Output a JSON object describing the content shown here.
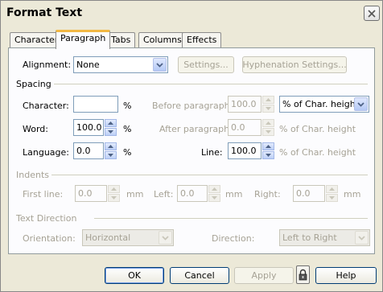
{
  "window": {
    "title": "Format Text"
  },
  "tabs": [
    {
      "label": "Character"
    },
    {
      "label": "Paragraph"
    },
    {
      "label": "Tabs"
    },
    {
      "label": "Columns"
    },
    {
      "label": "Effects"
    }
  ],
  "alignment": {
    "label": "Alignment:",
    "value": "None",
    "settings_label": "Settings...",
    "hyphenation_label": "Hyphenation Settings..."
  },
  "spacing": {
    "group_label": "Spacing",
    "character": {
      "label": "Character:",
      "value": "",
      "unit": "%"
    },
    "word": {
      "label": "Word:",
      "value": "100.0",
      "unit": "%"
    },
    "language": {
      "label": "Language:",
      "value": "0.0",
      "unit": "%"
    },
    "before_paragraph": {
      "label": "Before paragraph:",
      "value": "100.0",
      "unit_select": "% of Char. height"
    },
    "after_paragraph": {
      "label": "After paragraph:",
      "value": "0.0",
      "unit": "% of Char. height"
    },
    "line": {
      "label": "Line:",
      "value": "100.0",
      "unit": "% of Char. height"
    }
  },
  "indents": {
    "group_label": "Indents",
    "first_line": {
      "label": "First line:",
      "value": "0.0",
      "unit": "mm"
    },
    "left": {
      "label": "Left:",
      "value": "0.0",
      "unit": "mm"
    },
    "right": {
      "label": "Right:",
      "value": "0.0",
      "unit": "mm"
    }
  },
  "text_direction": {
    "group_label": "Text Direction",
    "orientation": {
      "label": "Orientation:",
      "value": "Horizontal"
    },
    "direction": {
      "label": "Direction:",
      "value": "Left to Right"
    }
  },
  "buttons": {
    "ok": "OK",
    "cancel": "Cancel",
    "apply": "Apply",
    "help": "Help"
  },
  "icons": {
    "close": "close-icon",
    "lock": "lock-icon",
    "dropdown": "chevron-down-icon",
    "spin_up": "spin-up-icon",
    "spin_down": "spin-down-icon"
  },
  "colors": {
    "accent_tab": "#f2b844",
    "dialog_bg": "#ece9d8",
    "panel_bg": "#fcfcfe",
    "disabled_text": "#a6a295"
  }
}
